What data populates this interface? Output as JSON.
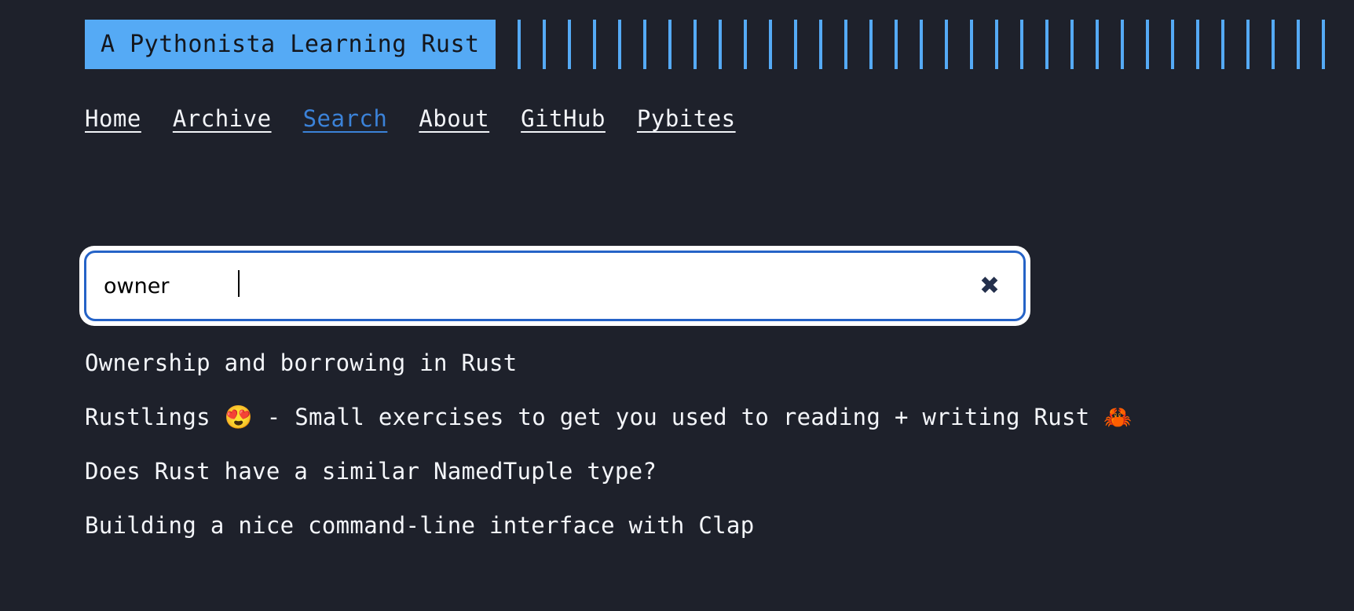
{
  "theme": {
    "background": "#1e212b",
    "accent_blue": "#55aaf5",
    "link_blue": "#3b82d8",
    "border_blue": "#2563c7",
    "text": "#f4f6fa",
    "title_text": "#14161c"
  },
  "header": {
    "site_title": "A Pythonista Learning Rust",
    "decorative_bar_count": 33
  },
  "nav": {
    "items": [
      {
        "label": "Home",
        "active": false
      },
      {
        "label": "Archive",
        "active": false
      },
      {
        "label": "Search",
        "active": true
      },
      {
        "label": "About",
        "active": false
      },
      {
        "label": "GitHub",
        "active": false
      },
      {
        "label": "Pybites",
        "active": false
      }
    ]
  },
  "search": {
    "value": "owner",
    "placeholder": "",
    "clear_label": "✖"
  },
  "results": {
    "items": [
      "Ownership and borrowing in Rust",
      "Rustlings 😍 - Small exercises to get you used to reading + writing Rust 🦀",
      "Does Rust have a similar NamedTuple type?",
      "Building a nice command-line interface with Clap"
    ]
  }
}
